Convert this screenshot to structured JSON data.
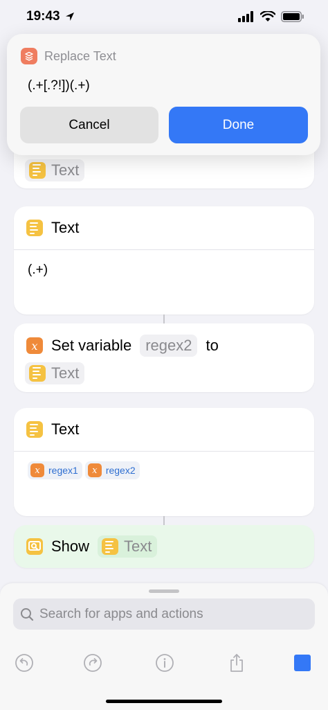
{
  "status_bar": {
    "time": "19:43"
  },
  "popup": {
    "title": "Replace Text",
    "text_value": "(.+[.?!])(.+)",
    "cancel_label": "Cancel",
    "done_label": "Done"
  },
  "cards": {
    "partial_token": "Text",
    "text1": {
      "title": "Text",
      "content": "(.+)"
    },
    "setvar": {
      "title": "Set variable",
      "var_name": "regex2",
      "to_label": "to",
      "token": "Text"
    },
    "text2": {
      "title": "Text",
      "tokens": [
        "regex1",
        "regex2"
      ]
    },
    "show": {
      "title": "Show",
      "token": "Text"
    }
  },
  "colors": {
    "accent": "#3478f6",
    "text_icon": "#f5c242",
    "variable_icon": "#ef8a3a",
    "replace_icon": "#ef7d60",
    "show_card": "#e9f8ea",
    "show_token": "#d9f1db"
  },
  "bottom_bar": {
    "search_placeholder": "Search for apps and actions",
    "icons": [
      "undo-icon",
      "redo-icon",
      "info-icon",
      "share-icon",
      "stop-icon"
    ]
  }
}
